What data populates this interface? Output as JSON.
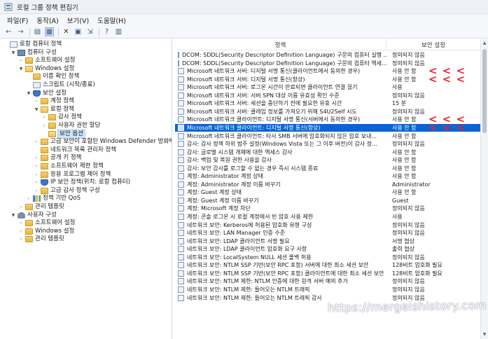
{
  "window": {
    "title": "로컬 그룹 정책 편집기"
  },
  "menu": [
    "파일(F)",
    "동작(A)",
    "보기(V)",
    "도움말(H)"
  ],
  "toolbar": [
    "back-icon",
    "forward-icon",
    "up-icon",
    "show-tree-icon",
    "delete-icon",
    "properties-icon",
    "export-icon",
    "help-icon",
    "view-icon"
  ],
  "tree": [
    {
      "label": "로컬 컴퓨터 정책",
      "level": 0,
      "toggle": "",
      "icon": "policy"
    },
    {
      "label": "컴퓨터 구성",
      "level": 1,
      "toggle": "▼",
      "icon": "pc"
    },
    {
      "label": "소프트웨어 설정",
      "level": 2,
      "toggle": "›",
      "icon": "folder"
    },
    {
      "label": "Windows 설정",
      "level": 2,
      "toggle": "▼",
      "icon": "folder-open"
    },
    {
      "label": "이름 확인 정책",
      "level": 3,
      "toggle": "",
      "icon": "folder"
    },
    {
      "label": "스크립트 (시작/종료)",
      "level": 3,
      "toggle": "",
      "icon": "doc"
    },
    {
      "label": "보안 설정",
      "level": 3,
      "toggle": "▼",
      "icon": "shield"
    },
    {
      "label": "계정 정책",
      "level": 4,
      "toggle": "›",
      "icon": "folder"
    },
    {
      "label": "로컬 정책",
      "level": 4,
      "toggle": "▼",
      "icon": "folder-open"
    },
    {
      "label": "감사 정책",
      "level": 5,
      "toggle": "›",
      "icon": "folder"
    },
    {
      "label": "사용자 권한 할당",
      "level": 5,
      "toggle": "›",
      "icon": "folder"
    },
    {
      "label": "보안 옵션",
      "level": 5,
      "toggle": "",
      "icon": "folder-open",
      "selected": true
    },
    {
      "label": "고급 보안이 포함된 Windows Defender 방화벽",
      "level": 4,
      "toggle": "›",
      "icon": "folder"
    },
    {
      "label": "네트워크 목록 관리자 정책",
      "level": 4,
      "toggle": "",
      "icon": "folder"
    },
    {
      "label": "공개 키 정책",
      "level": 4,
      "toggle": "›",
      "icon": "folder"
    },
    {
      "label": "소프트웨어 제한 정책",
      "level": 4,
      "toggle": "›",
      "icon": "folder"
    },
    {
      "label": "응용 프로그램 제어 정책",
      "level": 4,
      "toggle": "›",
      "icon": "folder"
    },
    {
      "label": "IP 보안 정책(위치: 로컬 컴퓨터)",
      "level": 4,
      "toggle": "›",
      "icon": "shield"
    },
    {
      "label": "고급 감사 정책 구성",
      "level": 4,
      "toggle": "›",
      "icon": "folder"
    },
    {
      "label": "정책 기반 QoS",
      "level": 3,
      "toggle": "›",
      "icon": "chart"
    },
    {
      "label": "관리 템플릿",
      "level": 2,
      "toggle": "›",
      "icon": "folder"
    },
    {
      "label": "사용자 구성",
      "level": 1,
      "toggle": "▼",
      "icon": "user"
    },
    {
      "label": "소프트웨어 설정",
      "level": 2,
      "toggle": "›",
      "icon": "folder"
    },
    {
      "label": "Windows 설정",
      "level": 2,
      "toggle": "›",
      "icon": "folder"
    },
    {
      "label": "관리 템플릿",
      "level": 2,
      "toggle": "›",
      "icon": "folder"
    }
  ],
  "list": {
    "header": {
      "policy": "정책",
      "setting": "보안 설정"
    },
    "rows": [
      {
        "policy": "DCOM: SDDL(Security Descriptor Definition Language) 구문의 컴퓨터 실행 ...",
        "setting": "정의되지 않음"
      },
      {
        "policy": "DCOM: SDDL(Security Descriptor Definition Language) 구문의 컴퓨터 액세...",
        "setting": "정의되지 않음"
      },
      {
        "policy": "Microsoft 네트워크 서버: 디지털 서명 통신(클라이언트에서 동의한 경우)",
        "setting": "사용 안 함",
        "marked": true
      },
      {
        "policy": "Microsoft 네트워크 서버: 디지털 서명 통신(항상)",
        "setting": "사용 안 함",
        "marked": true
      },
      {
        "policy": "Microsoft 네트워크 서버: 로그온 시간이 만료되면 클라이언트 연결 끊기",
        "setting": "사용"
      },
      {
        "policy": "Microsoft 네트워크 서버: 서버 SPN 대상 이름 유효성 확인 수준",
        "setting": "정의되지 않음"
      },
      {
        "policy": "Microsoft 네트워크 서버: 세션을 중단하기 전에 필요한 유휴 시간",
        "setting": "15 분"
      },
      {
        "policy": "Microsoft 네트워크 서버: 클레임 정보를 가져오기 위해 S4U2Self 시도",
        "setting": "정의되지 않음"
      },
      {
        "policy": "Microsoft 네트워크 클라이언트: 디지털 서명 통신(서버에서 동의한 경우)",
        "setting": "사용 안 함",
        "marked": true
      },
      {
        "policy": "Microsoft 네트워크 클라이언트: 디지털 서명 통신(항상)",
        "setting": "사용 안 함",
        "marked": true,
        "selected": true
      },
      {
        "policy": "Microsoft 네트워크 클라이언트: 타사 SMB 서버에 암호화되지 않은 암호 보내...",
        "setting": "사용 안 함"
      },
      {
        "policy": "감사: 감사 정책 하위 범주 설정(Windows Vista 또는 그 이후 버전)이 감사 정...",
        "setting": "정의되지 않음"
      },
      {
        "policy": "감사: 글로벌 시스템 개체에 대한 액세스 감사",
        "setting": "사용 안 함"
      },
      {
        "policy": "감사: 백업 및 복원 권한 사용을 감사",
        "setting": "사용 안 함"
      },
      {
        "policy": "감사: 보안 감사를 로그할 수 없는 경우 즉시 시스템 종료",
        "setting": "사용 안 함"
      },
      {
        "policy": "계정: Administrator 계정 상태",
        "setting": "사용 안 함"
      },
      {
        "policy": "계정: Administrator 계정 이름 바꾸기",
        "setting": "Administrator"
      },
      {
        "policy": "계정: Guest 계정 상태",
        "setting": "사용 안 함"
      },
      {
        "policy": "계정: Guest 계정 이름 바꾸기",
        "setting": "Guest"
      },
      {
        "policy": "계정: Microsoft 계정 차단",
        "setting": "정의되지 않음"
      },
      {
        "policy": "계정: 콘솔 로그온 시 로컬 계정에서 빈 암호 사용 제한",
        "setting": "사용"
      },
      {
        "policy": "네트워크 보안: Kerberos에 허용된 암호화 유형 구성",
        "setting": "정의되지 않음"
      },
      {
        "policy": "네트워크 보안: LAN Manager 인증 수준",
        "setting": "정의되지 않음"
      },
      {
        "policy": "네트워크 보안: LDAP 클라이언트 서명 필요",
        "setting": "서명 협상"
      },
      {
        "policy": "네트워크 보안: LDAP 클라이언트 암호화 요구 사항",
        "setting": "출력 협상"
      },
      {
        "policy": "네트워크 보안: LocalSystem NULL 세션 폴백 허용",
        "setting": "정의되지 않음"
      },
      {
        "policy": "네트워크 보안: NTLM SSP 기반(보안 RPC 포함) 서버에 대한 최소 세션 보안",
        "setting": "128비트 암호화 필요"
      },
      {
        "policy": "네트워크 보안: NTLM SSP 기반(보안 RPC 포함) 클라이언트에 대한 최소 세션 보안",
        "setting": "128비트 암호화 필요"
      },
      {
        "policy": "네트워크 보안: NTLM 제한: NTLM 인증에 대한 원격 서버 예외 추가",
        "setting": "정의되지 않음"
      },
      {
        "policy": "네트워크 보안: NTLM 제한: 들어오는 NTLM 트래픽",
        "setting": "정의되지 않음"
      },
      {
        "policy": "네트워크 보안: NTLM 제한: 들어오는 NTLM 트래픽 감사",
        "setting": "정의되지 않음"
      }
    ]
  },
  "annotation": {
    "mark": "< < <",
    "color": "#e8222a"
  },
  "watermark": "https://mergeishistory.com"
}
